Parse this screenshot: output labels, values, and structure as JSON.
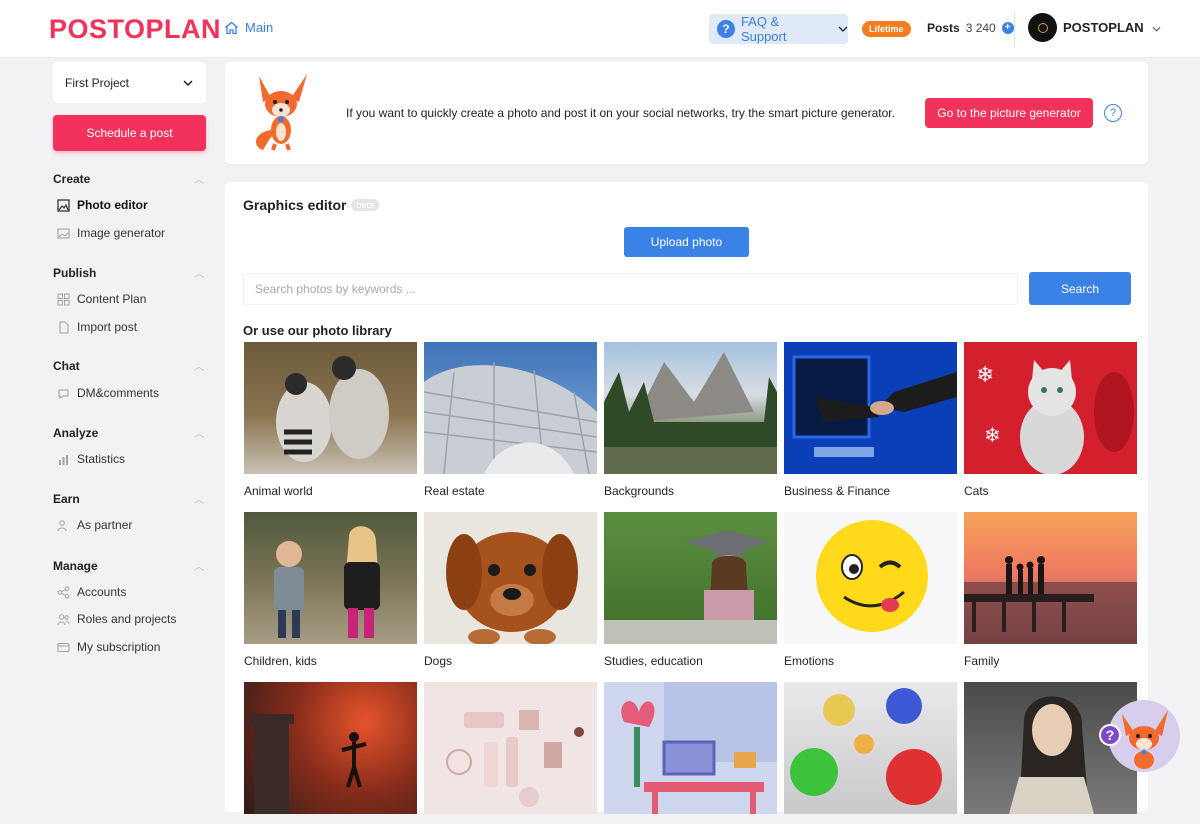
{
  "header": {
    "logo": "POSTOPLAN",
    "main_link": "Main",
    "faq_label": "FAQ & Support",
    "lifetime_badge": "Lifetime",
    "posts_label": "Posts",
    "posts_count": "3 240",
    "account_name": "POSTOPLAN"
  },
  "sidebar": {
    "project": "First Project",
    "schedule_button": "Schedule a post",
    "sections": {
      "create": {
        "title": "Create",
        "items": [
          "Photo editor",
          "Image generator"
        ]
      },
      "publish": {
        "title": "Publish",
        "items": [
          "Content Plan",
          "Import post"
        ]
      },
      "chat": {
        "title": "Chat",
        "items": [
          "DM&comments"
        ]
      },
      "analyze": {
        "title": "Analyze",
        "items": [
          "Statistics"
        ]
      },
      "earn": {
        "title": "Earn",
        "items": [
          "As partner"
        ]
      },
      "manage": {
        "title": "Manage",
        "items": [
          "Accounts",
          "Roles and projects",
          "My subscription"
        ]
      }
    }
  },
  "banner": {
    "text": "If you want to quickly create a photo and post it on your social networks, try the smart picture generator.",
    "button": "Go to the picture generator"
  },
  "editor": {
    "title": "Graphics editor",
    "beta": "beta",
    "upload_button": "Upload photo",
    "search_placeholder": "Search photos by keywords ...",
    "search_button": "Search",
    "library_title": "Or use our photo library",
    "categories": [
      "Animal world",
      "Real estate",
      "Backgrounds",
      "Business & Finance",
      "Cats",
      "Children, kids",
      "Dogs",
      "Studies, education",
      "Emotions",
      "Family",
      "",
      "",
      "",
      "",
      ""
    ]
  },
  "colors": {
    "brand": "#f2325a",
    "accent_blue": "#3b82e6",
    "lifetime": "#f57c1f"
  }
}
